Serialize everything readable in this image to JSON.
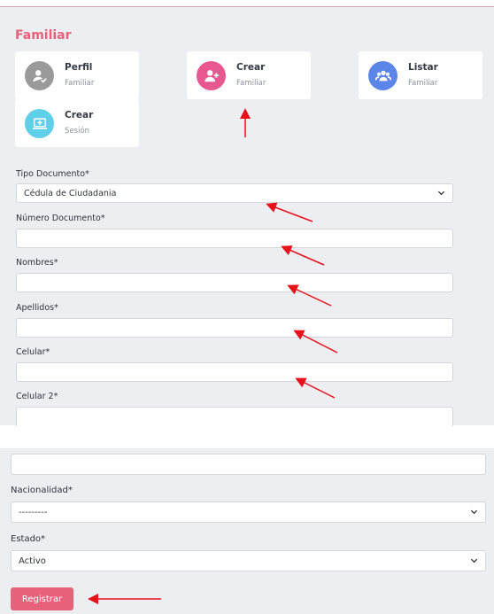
{
  "section": {
    "title": "Familiar"
  },
  "cards": [
    {
      "title": "Perfil",
      "subtitle": "Familiar",
      "icon": "user-check-icon",
      "color": "#9a9a9a"
    },
    {
      "title": "Crear",
      "subtitle": "Familiar",
      "icon": "user-plus-icon",
      "color": "#e8578f"
    },
    {
      "title": "Listar",
      "subtitle": "Familiar",
      "icon": "users-icon",
      "color": "#5b85e8"
    },
    {
      "title": "Crear",
      "subtitle": "Sesión",
      "icon": "laptop-plus-icon",
      "color": "#5fd0e8"
    }
  ],
  "form": {
    "tipo_documento": {
      "label": "Tipo Documento*",
      "value": "Cédula de Ciudadania"
    },
    "numero_documento": {
      "label": "Número Documento*",
      "value": ""
    },
    "nombres": {
      "label": "Nombres*",
      "value": ""
    },
    "apellidos": {
      "label": "Apellidos*",
      "value": ""
    },
    "celular": {
      "label": "Celular*",
      "value": ""
    },
    "celular2": {
      "label": "Celular 2*",
      "value": ""
    },
    "nacionalidad": {
      "label": "Nacionalidad*",
      "value": "---------"
    },
    "estado": {
      "label": "Estado*",
      "value": "Activo"
    }
  },
  "actions": {
    "register_label": "Registrar"
  },
  "annotation_color": "#e8101b"
}
